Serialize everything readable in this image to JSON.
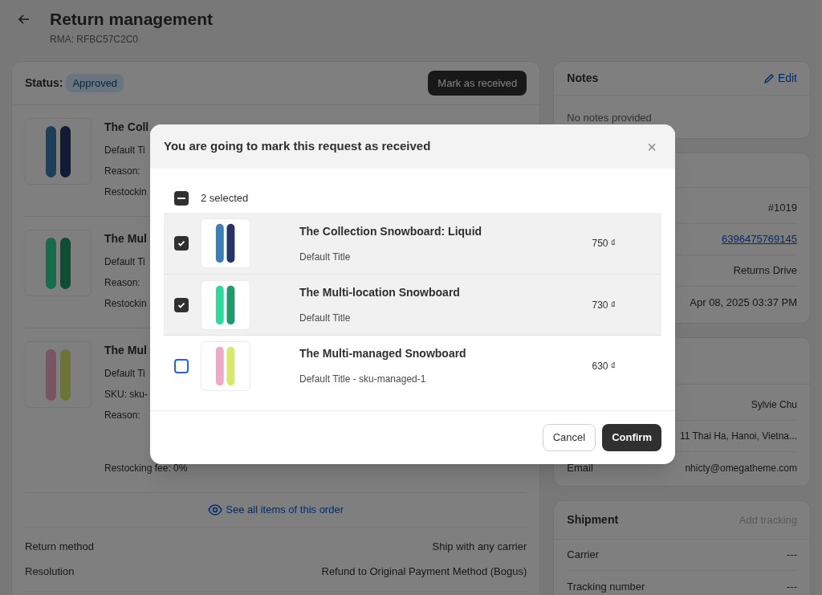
{
  "page": {
    "title": "Return management",
    "subtitle": "RMA: RFBC57C2C0"
  },
  "status_card": {
    "status_label": "Status:",
    "status": "Approved",
    "action": "Mark as received",
    "items": [
      {
        "title": "The Coll",
        "lines": [
          "Default Ti",
          "Reason:",
          "Restockin"
        ]
      },
      {
        "title": "The Mul",
        "lines": [
          "Default Ti",
          "Reason:",
          "Restockin"
        ]
      },
      {
        "title": "The Mul",
        "lines": [
          "Default Ti",
          "SKU: sku-",
          "Reason:",
          "Restocking fee: 0%"
        ]
      }
    ],
    "see_all": "See all items of this order",
    "details": [
      {
        "label": "Return method",
        "value": "Ship with any carrier"
      },
      {
        "label": "Resolution",
        "value": "Refund to Original Payment Method (Bogus)"
      }
    ]
  },
  "notes": {
    "title": "Notes",
    "edit": "Edit",
    "text": "No notes provided"
  },
  "order": {
    "rows": [
      {
        "kind": "text",
        "value": "#1019"
      },
      {
        "kind": "link",
        "value": "6396475769145"
      },
      {
        "kind": "text",
        "value": "Returns Drive"
      },
      {
        "kind": "text",
        "value": "Apr 08, 2025 03:37 PM"
      }
    ]
  },
  "customer": {
    "rows": [
      {
        "label": "",
        "value": "Sylvie Chu"
      },
      {
        "label": "",
        "value": "11 Thai Ha, Hanoi, Vietna..."
      },
      {
        "label": "Email",
        "value": "nhicty@omegatheme.com"
      }
    ]
  },
  "shipment": {
    "title": "Shipment",
    "action": "Add tracking",
    "rows": [
      {
        "label": "Carrier",
        "value": "---"
      },
      {
        "label": "Tracking number",
        "value": "---"
      }
    ]
  },
  "modal": {
    "title": "You are going to mark this request as received",
    "close": "×",
    "bulk": {
      "label": "2 selected",
      "indeterminate": true
    },
    "items": [
      {
        "title": "The Collection Snowboard: Liquid",
        "subtitle": "Default Title",
        "price": "750 ₫",
        "checked": true
      },
      {
        "title": "The Multi-location Snowboard",
        "subtitle": "Default Title",
        "price": "730 ₫",
        "checked": true
      },
      {
        "title": "The Multi-managed Snowboard",
        "subtitle": "Default Title - sku-managed-1",
        "price": "630 ₫",
        "checked": false
      }
    ],
    "cancel": "Cancel",
    "confirm": "Confirm"
  }
}
